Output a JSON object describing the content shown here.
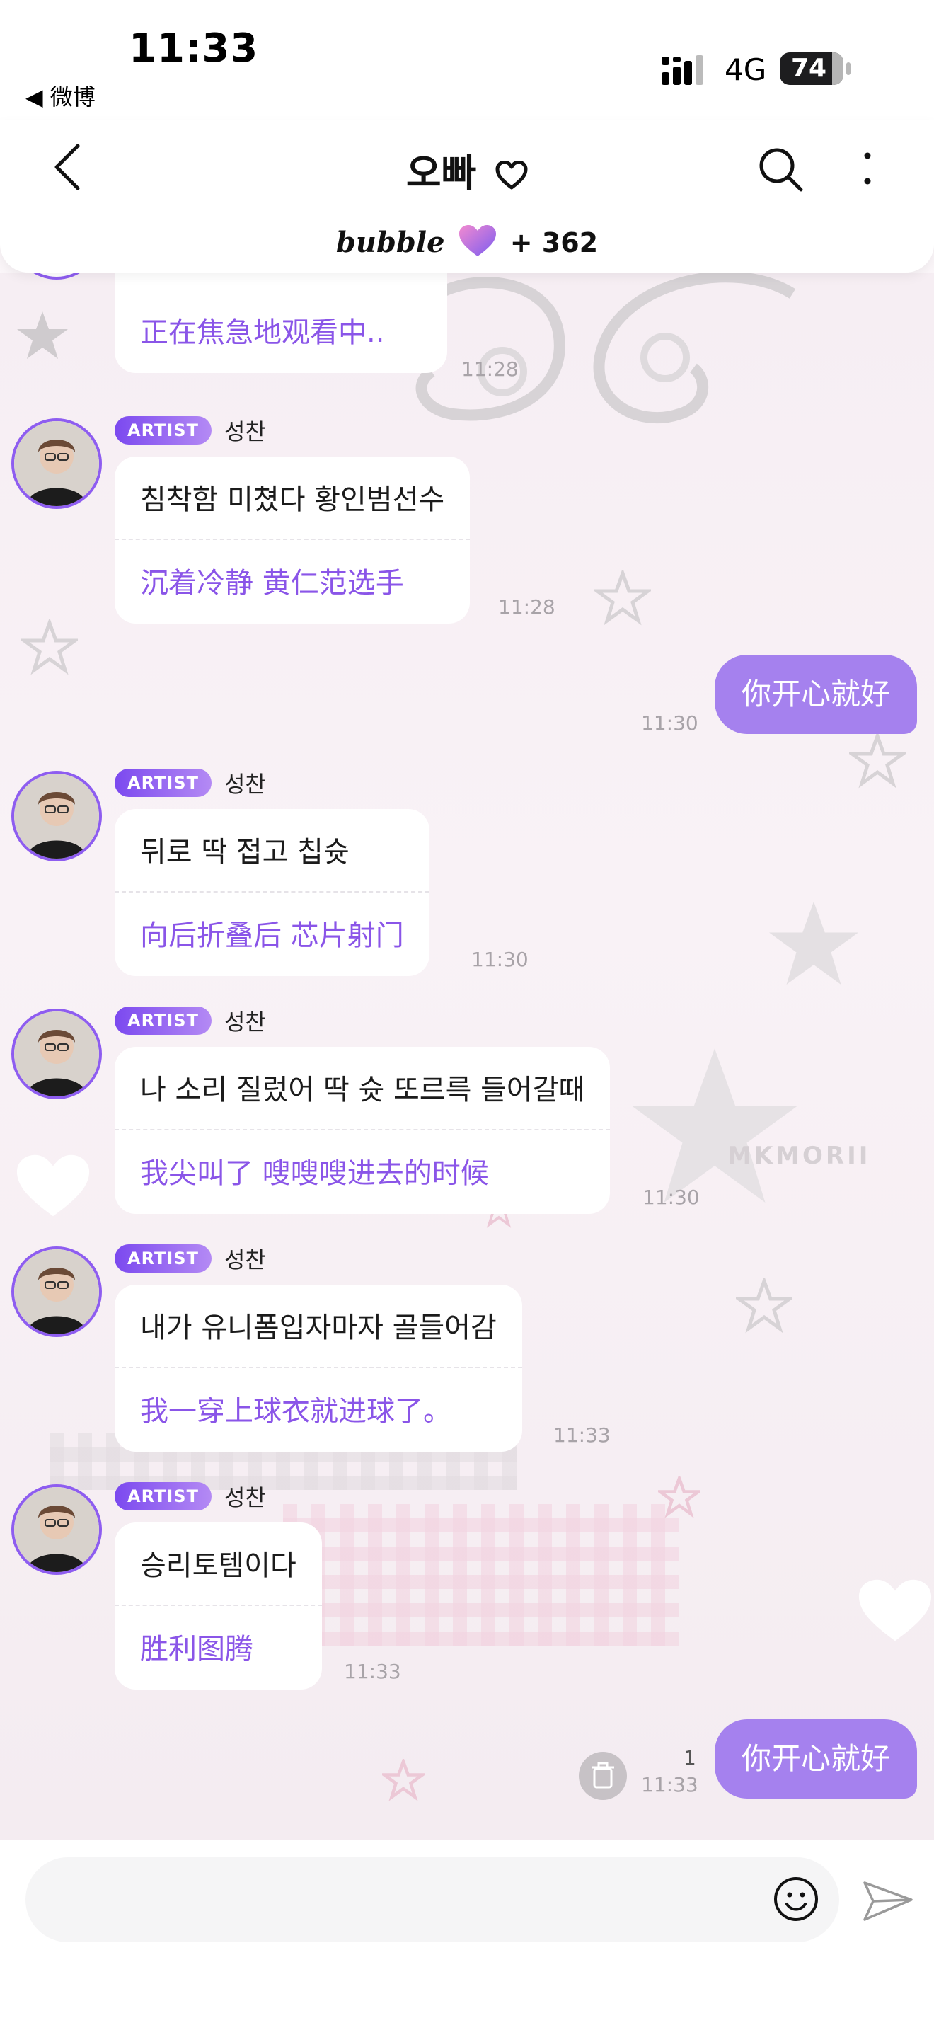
{
  "status_bar": {
    "time": "11:33",
    "back_app": "◀ 微博",
    "network": "4G",
    "battery": "74"
  },
  "header": {
    "title": "오빠",
    "bubble_logo": "bubble",
    "subscriber_count": "+ 362"
  },
  "messages": {
    "partial": {
      "zh": "正在焦急地观看中..",
      "time": "11:28"
    },
    "m1": {
      "badge": "ARTIST",
      "name": "성찬",
      "ko": "침착함 미쳤다 황인범선수",
      "zh": "沉着冷静 黄仁范选手",
      "time": "11:28"
    },
    "mine1": {
      "text": "你开心就好",
      "time": "11:30"
    },
    "m2": {
      "badge": "ARTIST",
      "name": "성찬",
      "ko": "뒤로 딱 접고 칩슛",
      "zh": "向后折叠后 芯片射门",
      "time": "11:30"
    },
    "m3": {
      "badge": "ARTIST",
      "name": "성찬",
      "ko": "나 소리 질렀어 딱 슛 또르륵 들어갈때",
      "zh": "我尖叫了 嗖嗖嗖进去的时候",
      "time": "11:30"
    },
    "m4": {
      "badge": "ARTIST",
      "name": "성찬",
      "ko": "내가 유니폼입자마자 골들어감",
      "zh": "我一穿上球衣就进球了。",
      "time": "11:33"
    },
    "m5": {
      "badge": "ARTIST",
      "name": "성찬",
      "ko": "승리토템이다",
      "zh": "胜利图腾",
      "time": "11:33"
    },
    "mine2": {
      "text": "你开心就好",
      "time": "11:33",
      "read_count": "1"
    }
  },
  "watermark": "MKMORII",
  "input": {
    "placeholder": "",
    "value": ""
  },
  "icons": {
    "back": "chevron-left-icon",
    "heart": "heart-outline-icon",
    "search": "search-icon",
    "more": "more-vertical-icon",
    "emoji": "smiley-icon",
    "send": "paper-plane-icon",
    "trash": "trash-icon"
  },
  "colors": {
    "accent": "#8a55e8",
    "my_bubble": "#a581ee",
    "badge_start": "#7b49ef",
    "badge_end": "#b48af4"
  }
}
